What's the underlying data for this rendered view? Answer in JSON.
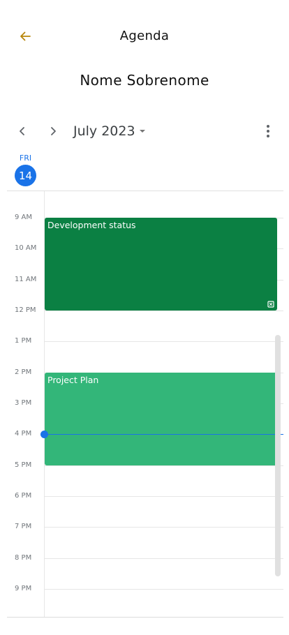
{
  "appbar": {
    "title": "Agenda",
    "back_icon": "arrow-left-icon",
    "back_color": "#b8860b"
  },
  "user": {
    "name": "Nome Sobrenome"
  },
  "calendar": {
    "month_label": "July 2023",
    "day": {
      "weekday": "FRI",
      "date": "14"
    },
    "hours": [
      "9 AM",
      "10 AM",
      "11 AM",
      "12 PM",
      "1 PM",
      "2 PM",
      "3 PM",
      "4 PM",
      "5 PM",
      "6 PM",
      "7 PM",
      "8 PM",
      "9 PM"
    ],
    "events": [
      {
        "title": "Development status",
        "start": "9 AM",
        "end": "12 PM",
        "color": "#0b8043",
        "icon": "recurring-icon"
      },
      {
        "title": "Project Plan",
        "start": "2 PM",
        "end": "5 PM",
        "color": "#33b679"
      }
    ],
    "current_time": "4 PM",
    "accent": "#1a73e8"
  }
}
